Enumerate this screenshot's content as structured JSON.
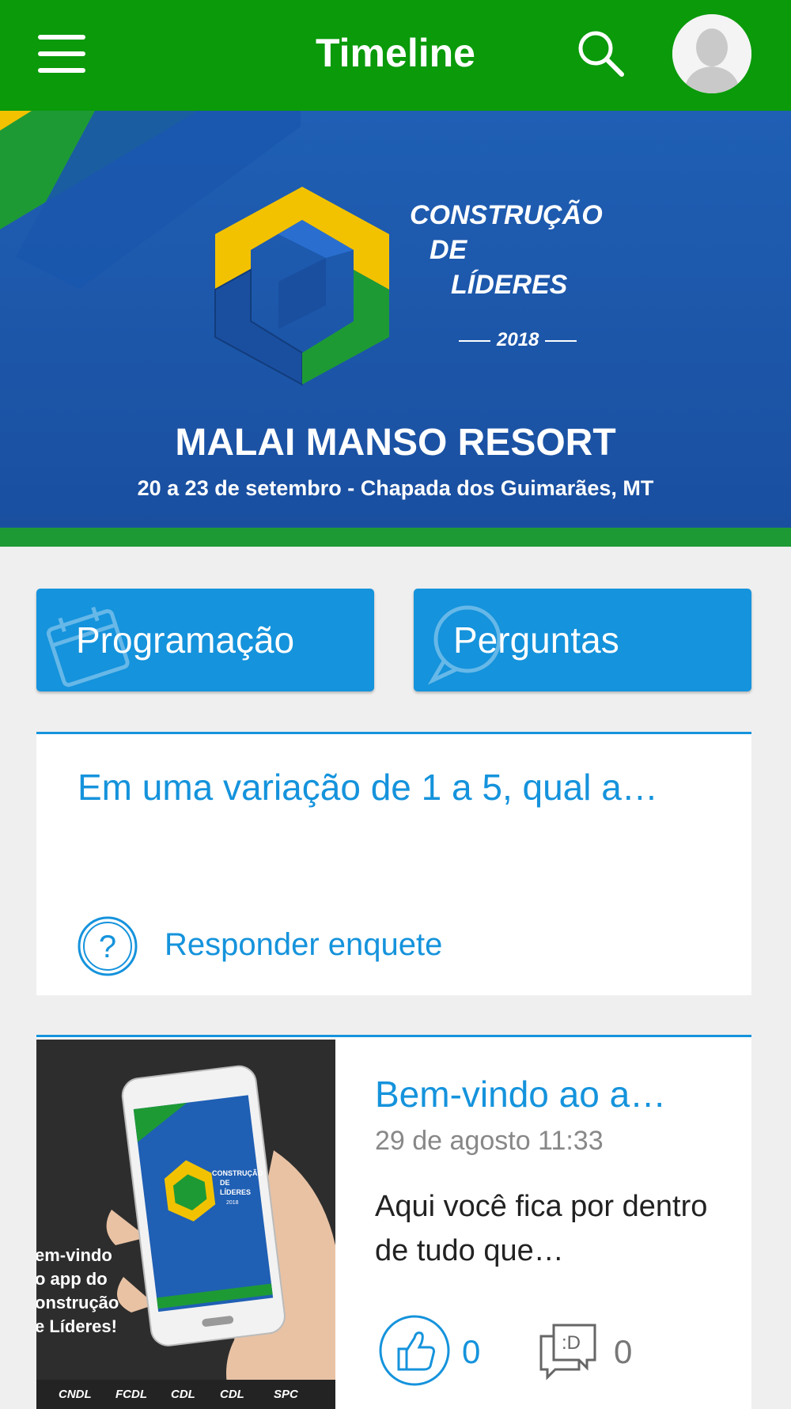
{
  "appbar": {
    "title": "Timeline"
  },
  "banner": {
    "logo_line1": "CONSTRUÇÃO",
    "logo_line2": "DE",
    "logo_line3": "LÍDERES",
    "logo_year": "2018",
    "venue": "MALAI MANSO RESORT",
    "dates": "20 a 23 de setembro - Chapada dos Guimarães, MT"
  },
  "tiles": [
    {
      "label": "Programação",
      "icon": "calendar-icon"
    },
    {
      "label": "Perguntas",
      "icon": "chat-bubble-icon"
    }
  ],
  "poll": {
    "question": "Em uma variação de 1 a 5, qual a…",
    "action_label": "Responder enquete",
    "icon": "question-circle-icon"
  },
  "post": {
    "title": "Bem-vindo ao a…",
    "date": "29 de agosto 11:33",
    "body": "Aqui você fica por dentro de tudo que…",
    "likes": "0",
    "comments": "0",
    "image_text": [
      "em-vindo",
      "o app do",
      "onstrução",
      "e Líderes!"
    ],
    "image_logos": [
      "CNDL",
      "FCDL",
      "CDL",
      "CDL",
      "SPC"
    ],
    "phone_logo_lines": [
      "CONSTRUÇÃO",
      "DE",
      "LÍDERES",
      "2018"
    ]
  },
  "colors": {
    "appbar": "#0a9a0a",
    "accent": "#1593dc",
    "banner": "#1f5fb4",
    "stripe": "#1e9a35"
  }
}
